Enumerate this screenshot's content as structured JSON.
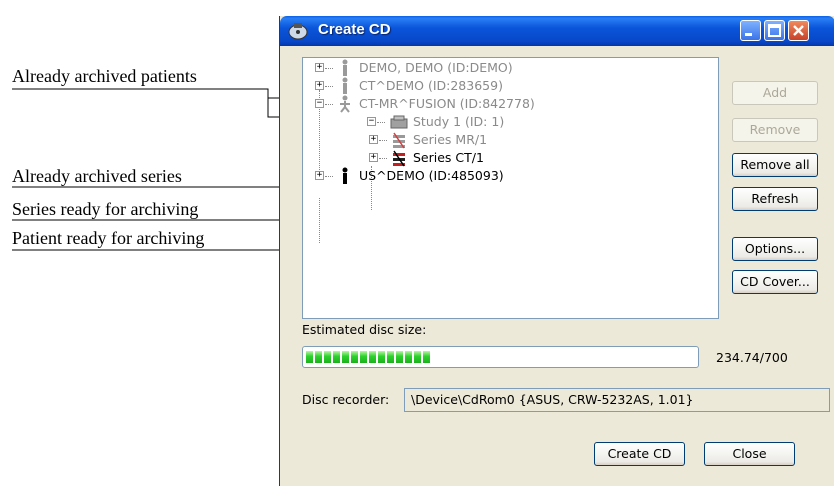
{
  "annotations": {
    "archived_patients": "Already archived patients",
    "archived_series": "Already archived series",
    "series_ready": "Series ready for archiving",
    "patient_ready": "Patient ready for archiving"
  },
  "window": {
    "title": "Create CD"
  },
  "tree": {
    "patient1": "DEMO, DEMO (ID:DEMO)",
    "patient2": "CT^DEMO (ID:283659)",
    "patient3": "CT-MR^FUSION (ID:842778)",
    "study": "Study 1 (ID: 1)",
    "series1": "Series MR/1",
    "series2": "Series CT/1",
    "patient4": "US^DEMO (ID:485093)"
  },
  "buttons": {
    "add": "Add",
    "remove": "Remove",
    "remove_all": "Remove all",
    "refresh": "Refresh",
    "options": "Options...",
    "cd_cover": "CD Cover...",
    "create_cd": "Create CD",
    "close": "Close"
  },
  "disc": {
    "size_label": "Estimated disc size:",
    "size_value": "234.74/700",
    "used": 234.74,
    "capacity": 700,
    "recorder_label": "Disc recorder:",
    "recorder_value": "\\Device\\CdRom0 {ASUS, CRW-5232AS, 1.01}"
  },
  "colors": {
    "titlebar": "#0a55da",
    "progress_fill": "#2bd12b",
    "archived_text": "#8a8a8a"
  }
}
